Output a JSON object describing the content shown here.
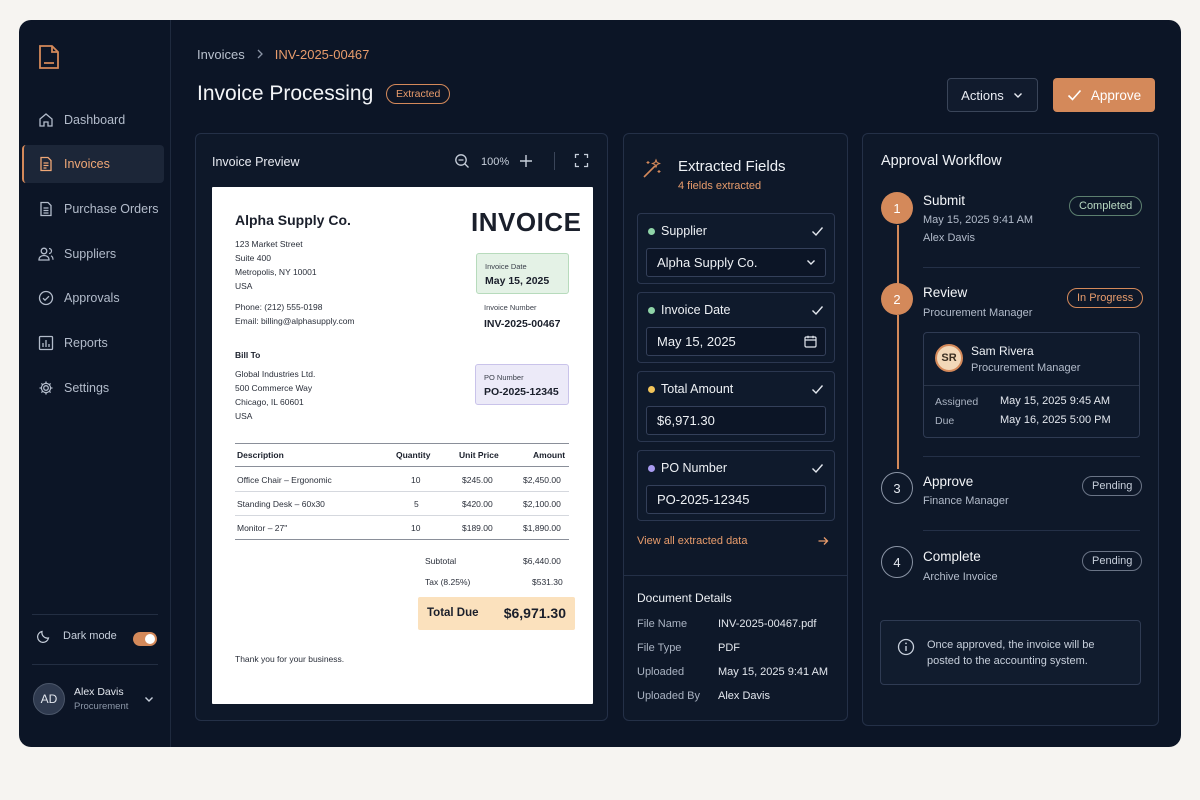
{
  "sidebar": {
    "items": [
      {
        "label": "Dashboard",
        "icon": "home-icon"
      },
      {
        "label": "Invoices",
        "icon": "invoice-icon",
        "active": true
      },
      {
        "label": "Purchase Orders",
        "icon": "purchase-order-icon"
      },
      {
        "label": "Suppliers",
        "icon": "users-icon"
      },
      {
        "label": "Approvals",
        "icon": "check-circle-icon"
      },
      {
        "label": "Reports",
        "icon": "bar-chart-icon"
      },
      {
        "label": "Settings",
        "icon": "gear-icon"
      }
    ],
    "dark_mode_label": "Dark mode",
    "dark_mode_on": true,
    "user": {
      "initials": "AD",
      "name": "Alex Davis",
      "role": "Procurement"
    }
  },
  "header": {
    "breadcrumb_root": "Invoices",
    "breadcrumb_current": "INV-2025-00467",
    "title": "Invoice Processing",
    "status_badge": "Extracted",
    "actions_label": "Actions",
    "approve_label": "Approve"
  },
  "preview": {
    "title": "Invoice Preview",
    "zoom": "100%",
    "invoice": {
      "company": "Alpha Supply Co.",
      "heading": "INVOICE",
      "address": [
        "123 Market Street",
        "Suite 400",
        "Metropolis, NY 10001",
        "USA"
      ],
      "phone": "Phone: (212) 555-0198",
      "email": "Email:  billing@alphasupply.com",
      "date_label": "Invoice Date",
      "date_value": "May 15, 2025",
      "number_label": "Invoice Number",
      "number_value": "INV-2025-00467",
      "bill_to_label": "Bill To",
      "bill_to": [
        "Global Industries Ltd.",
        "500 Commerce Way",
        "Chicago, IL 60601",
        "USA"
      ],
      "po_label": "PO Number",
      "po_value": "PO-2025-12345",
      "columns": [
        "Description",
        "Quantity",
        "Unit Price",
        "Amount"
      ],
      "rows": [
        [
          "Office Chair – Ergonomic",
          "10",
          "$245.00",
          "$2,450.00"
        ],
        [
          "Standing Desk – 60x30",
          "5",
          "$420.00",
          "$2,100.00"
        ],
        [
          "Monitor – 27\"",
          "10",
          "$189.00",
          "$1,890.00"
        ]
      ],
      "subtotal_label": "Subtotal",
      "subtotal_value": "$6,440.00",
      "tax_label": "Tax (8.25%)",
      "tax_value": "$531.30",
      "total_label": "Total Due",
      "total_value": "$6,971.30",
      "footer": "Thank you for your business."
    }
  },
  "extracted": {
    "title": "Extracted Fields",
    "subtitle": "4 fields extracted",
    "fields": [
      {
        "label": "Supplier",
        "value": "Alpha Supply Co.",
        "dot": "#8fd4a8",
        "suffix_icon": "chevron-down-icon"
      },
      {
        "label": "Invoice Date",
        "value": "May 15, 2025",
        "dot": "#8fd4a8",
        "suffix_icon": "calendar-icon"
      },
      {
        "label": "Total Amount",
        "value": "$6,971.30",
        "dot": "#f2c45a"
      },
      {
        "label": "PO Number",
        "value": "PO-2025-12345",
        "dot": "#a99bf0"
      }
    ],
    "view_all": "View all extracted data",
    "details": {
      "title": "Document Details",
      "rows": [
        {
          "label": "File Name",
          "value": "INV-2025-00467.pdf"
        },
        {
          "label": "File Type",
          "value": "PDF"
        },
        {
          "label": "Uploaded",
          "value": "May 15, 2025 9:41 AM"
        },
        {
          "label": "Uploaded By",
          "value": "Alex Davis"
        }
      ]
    }
  },
  "workflow": {
    "title": "Approval Workflow",
    "steps": [
      {
        "num": "1",
        "name": "Submit",
        "sub1": "May 15, 2025 9:41 AM",
        "sub2": "Alex Davis",
        "status": "Completed"
      },
      {
        "num": "2",
        "name": "Review",
        "sub1": "Procurement Manager",
        "status": "In Progress"
      },
      {
        "num": "3",
        "name": "Approve",
        "sub1": "Finance Manager",
        "status": "Pending"
      },
      {
        "num": "4",
        "name": "Complete",
        "sub1": "Archive Invoice",
        "status": "Pending"
      }
    ],
    "assignee": {
      "initials": "SR",
      "name": "Sam Rivera",
      "role": "Procurement Manager",
      "assigned_label": "Assigned",
      "assigned_value": "May 15, 2025 9:45 AM",
      "due_label": "Due",
      "due_value": "May 16, 2025 5:00 PM"
    },
    "info": "Once approved, the invoice will be posted to the accounting system."
  },
  "colors": {
    "accent": "#d4895a",
    "background": "#0c1526",
    "page": "#f6f4f1"
  }
}
